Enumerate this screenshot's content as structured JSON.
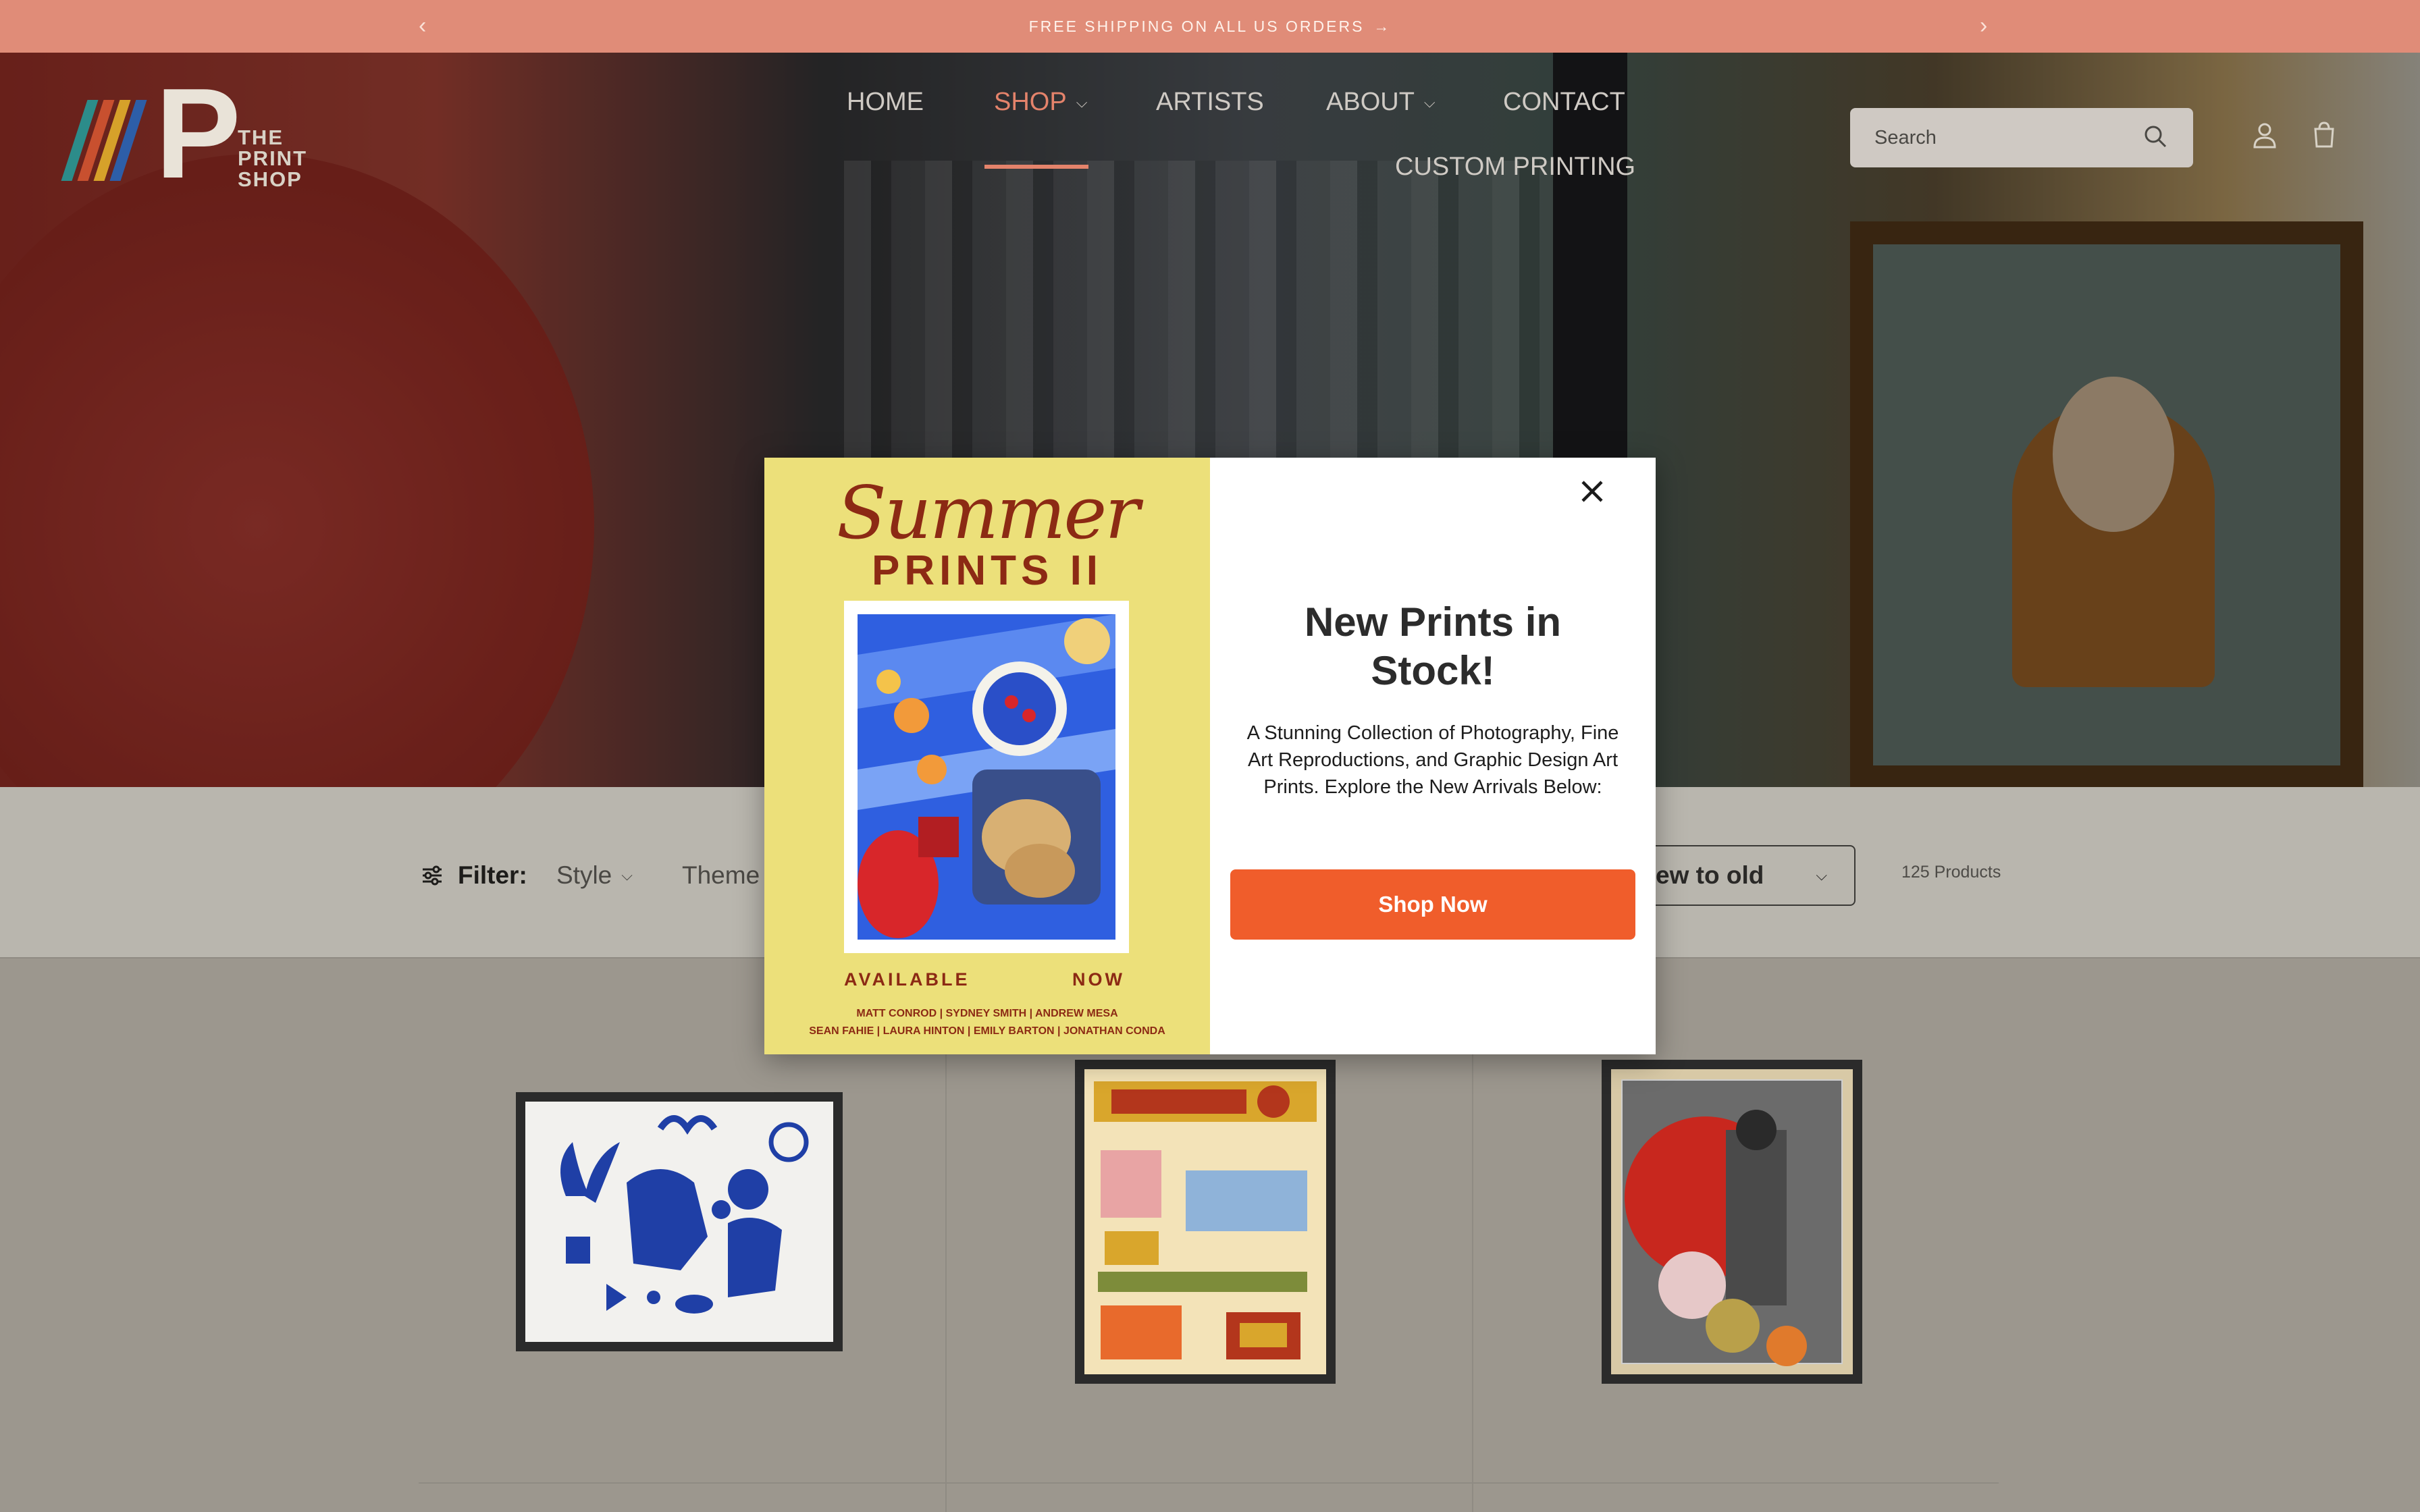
{
  "announcement": {
    "text": "FREE SHIPPING ON ALL US ORDERS",
    "prev_icon": "chevron-left-icon",
    "next_icon": "chevron-right-icon",
    "arrow_icon": "arrow-right-icon"
  },
  "logo": {
    "letter": "P",
    "line1": "THE",
    "line2": "PRINT",
    "line3": "SHOP",
    "stripe_colors": [
      "#2c8c8a",
      "#c8502f",
      "#d6a12a",
      "#2d5ea8"
    ]
  },
  "nav": {
    "items": [
      {
        "label": "HOME",
        "has_dropdown": false
      },
      {
        "label": "SHOP",
        "has_dropdown": true,
        "active": true
      },
      {
        "label": "ARTISTS",
        "has_dropdown": false
      },
      {
        "label": "ABOUT",
        "has_dropdown": true
      },
      {
        "label": "CONTACT",
        "has_dropdown": false
      },
      {
        "label": "CUSTOM PRINTING",
        "has_dropdown": false
      }
    ]
  },
  "search": {
    "placeholder": "Search",
    "icon": "search-icon"
  },
  "header_icons": [
    "account-icon",
    "cart-icon"
  ],
  "filters": {
    "label": "Filter:",
    "options": [
      "Style",
      "Theme"
    ],
    "sort_value": "ew to old",
    "product_count": "125 Products"
  },
  "modal": {
    "poster": {
      "title_script": "Summer",
      "title_block": "PRINTS II",
      "available": "AVAILABLE",
      "now": "NOW",
      "artists_line1": "MATT CONROD  |  SYDNEY SMITH |  ANDREW MESA",
      "artists_line2": "SEAN FAHIE |  LAURA HINTON  |  EMILY BARTON  |  JONATHAN CONDA"
    },
    "title": "New Prints in Stock!",
    "description": "A Stunning Collection of Photography, Fine Art Reproductions, and Graphic Design Art Prints. Explore the New Arrivals Below:",
    "cta": "Shop Now",
    "close_icon": "close-icon"
  },
  "colors": {
    "announcement_bg": "#e08c78",
    "accent": "#f05d2b",
    "nav_active": "#e4836b",
    "poster_bg": "#ece07a",
    "poster_text": "#8c2a14"
  }
}
